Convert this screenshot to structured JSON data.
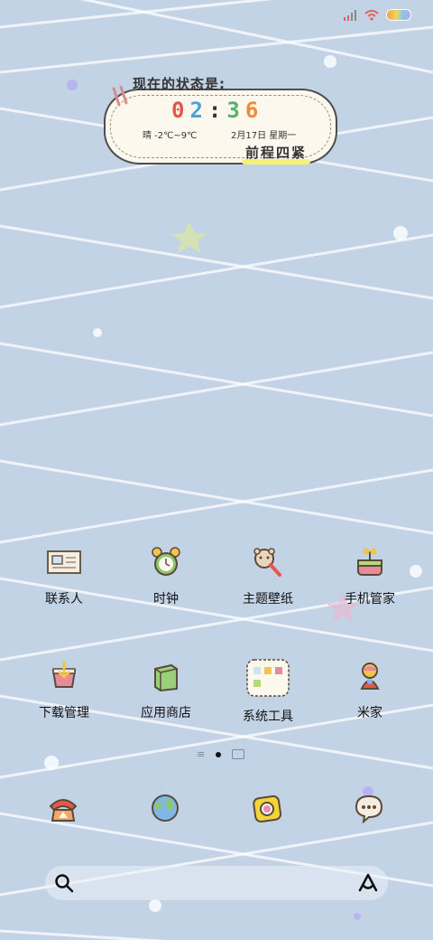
{
  "status_bar": {
    "icons": [
      "signal-icon",
      "wifi-icon",
      "battery-icon"
    ]
  },
  "widget": {
    "header": "现在的状态是:",
    "time_digits": [
      "0",
      "2",
      ":",
      "3",
      "6"
    ],
    "weather": "晴 -2℃~9℃",
    "date": "2月17日 星期一",
    "motto": "前程四紧"
  },
  "apps": [
    {
      "label": "联系人",
      "icon": "contacts-icon"
    },
    {
      "label": "时钟",
      "icon": "alarm-clock-icon"
    },
    {
      "label": "主题壁纸",
      "icon": "theme-icon"
    },
    {
      "label": "手机管家",
      "icon": "security-icon"
    },
    {
      "label": "下载管理",
      "icon": "download-icon"
    },
    {
      "label": "应用商店",
      "icon": "app-store-icon"
    },
    {
      "label": "系统工具",
      "icon": "folder-icon"
    },
    {
      "label": "米家",
      "icon": "mijia-icon"
    }
  ],
  "pager": {
    "current_page": 1
  },
  "dock": [
    "phone-icon",
    "browser-icon",
    "camera-icon",
    "messages-icon"
  ],
  "search_bar": {
    "icons": [
      "search-icon",
      "assistant-icon"
    ]
  },
  "colors": {
    "background": "#c3d3e6",
    "time_colors": [
      "#e6574a",
      "#49a2d8",
      "#333333",
      "#55b36b",
      "#f08a3a"
    ]
  }
}
